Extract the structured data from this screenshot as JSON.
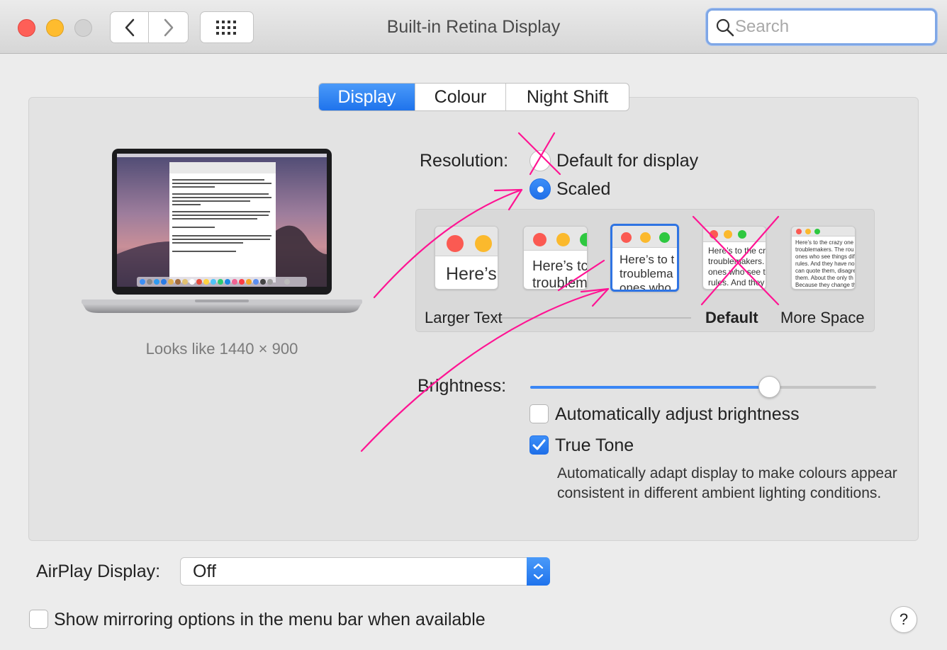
{
  "window": {
    "title": "Built-in Retina Display",
    "search_placeholder": "Search"
  },
  "tabs": [
    {
      "label": "Display",
      "active": true
    },
    {
      "label": "Colour",
      "active": false
    },
    {
      "label": "Night Shift",
      "active": false
    }
  ],
  "display_preview": {
    "looks_like": "Looks like 1440 × 900"
  },
  "resolution": {
    "label": "Resolution:",
    "options": [
      {
        "label": "Default for display",
        "selected": false
      },
      {
        "label": "Scaled",
        "selected": true
      }
    ]
  },
  "scaled": {
    "thumbnails": [
      {
        "text_line1": "Here’s",
        "text_line2": ""
      },
      {
        "text_line1": "Here’s tc",
        "text_line2": "troublem"
      },
      {
        "text_line1": "Here’s to t",
        "text_line2": "troublema",
        "text_line3": "ones who",
        "selected": true
      },
      {
        "text_line1": "Here’s to the cr",
        "text_line2": "troublemakers.",
        "text_line3": "ones who see t",
        "text_line4": "rules. And they"
      },
      {
        "text_line1": "Here’s to the crazy one",
        "text_line2": "troublemakers. The rou",
        "text_line3": "ones who see things dif",
        "text_line4": "rules. And they have no",
        "text_line5": "can quote them, disagre",
        "text_line6": "them. About the only th",
        "text_line7": "Because they change th"
      }
    ],
    "larger_text_label": "Larger Text",
    "default_label": "Default",
    "more_space_label": "More Space"
  },
  "brightness": {
    "label": "Brightness:",
    "level": 0.69,
    "auto_label": "Automatically adjust brightness",
    "auto_checked": false,
    "true_tone_label": "True Tone",
    "true_tone_checked": true,
    "true_tone_description": "Automatically adapt display to make colours appear consistent in different ambient lighting conditions."
  },
  "airplay": {
    "label": "AirPlay Display:",
    "value": "Off"
  },
  "mirroring": {
    "label": "Show mirroring options in the menu bar when available",
    "checked": false
  },
  "help": {
    "label": "?"
  },
  "colors": {
    "accent": "#1f73ec",
    "annotation": "#ff1493"
  }
}
